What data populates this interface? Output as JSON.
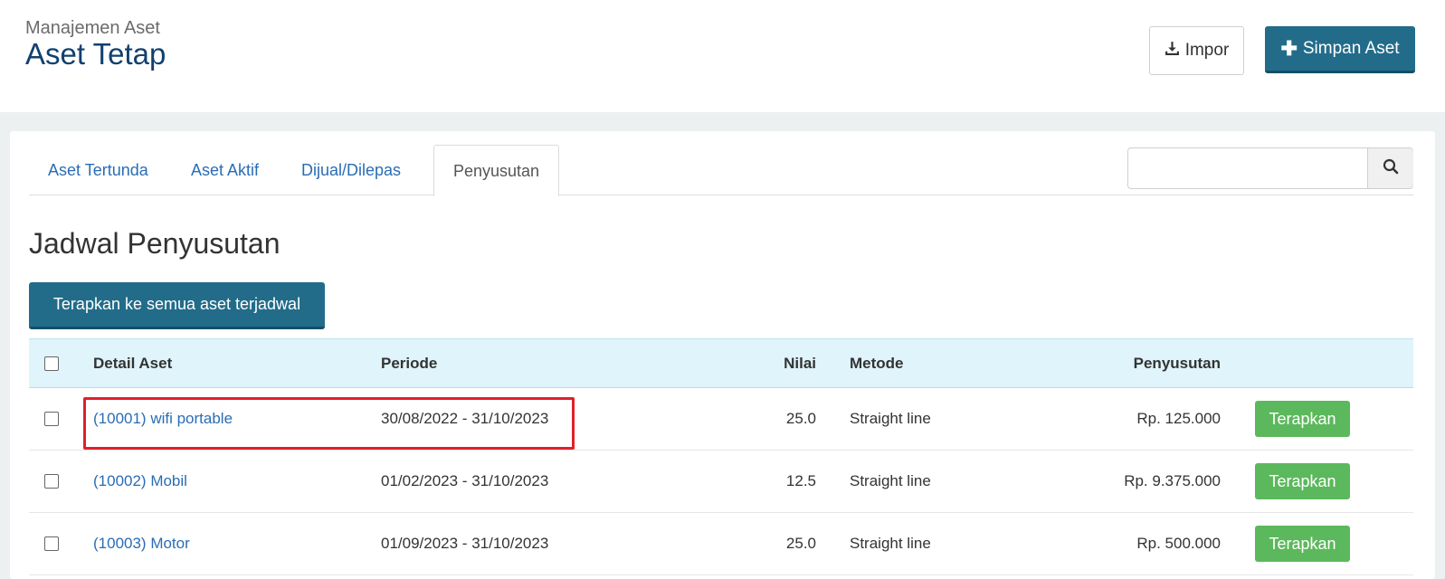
{
  "header": {
    "breadcrumb": "Manajemen Aset",
    "title": "Aset Tetap",
    "impor_label": "Impor",
    "simpan_label": "Simpan Aset"
  },
  "tabs": [
    {
      "label": "Aset Tertunda"
    },
    {
      "label": "Aset Aktif"
    },
    {
      "label": "Dijual/Dilepas"
    },
    {
      "label": "Penyusutan",
      "active": true
    }
  ],
  "search": {
    "placeholder": "",
    "value": ""
  },
  "section": {
    "title": "Jadwal Penyusutan",
    "apply_all_label": "Terapkan ke semua aset terjadwal"
  },
  "table": {
    "headers": {
      "detail": "Detail Aset",
      "periode": "Periode",
      "nilai": "Nilai",
      "metode": "Metode",
      "penyusutan": "Penyusutan"
    },
    "rows": [
      {
        "detail": "(10001) wifi portable",
        "periode": "30/08/2022 - 31/10/2023",
        "nilai": "25.0",
        "metode": "Straight line",
        "penyusutan": "Rp. 125.000",
        "action": "Terapkan"
      },
      {
        "detail": "(10002) Mobil",
        "periode": "01/02/2023 - 31/10/2023",
        "nilai": "12.5",
        "metode": "Straight line",
        "penyusutan": "Rp. 9.375.000",
        "action": "Terapkan"
      },
      {
        "detail": "(10003) Motor",
        "periode": "01/09/2023 - 31/10/2023",
        "nilai": "25.0",
        "metode": "Straight line",
        "penyusutan": "Rp. 500.000",
        "action": "Terapkan"
      }
    ]
  },
  "colors": {
    "primary": "#226c8a",
    "title": "#12406f",
    "link": "#2a6db5",
    "success": "#5cb85c",
    "highlight": "#e0202a",
    "table_header_bg": "#dff4fb"
  }
}
